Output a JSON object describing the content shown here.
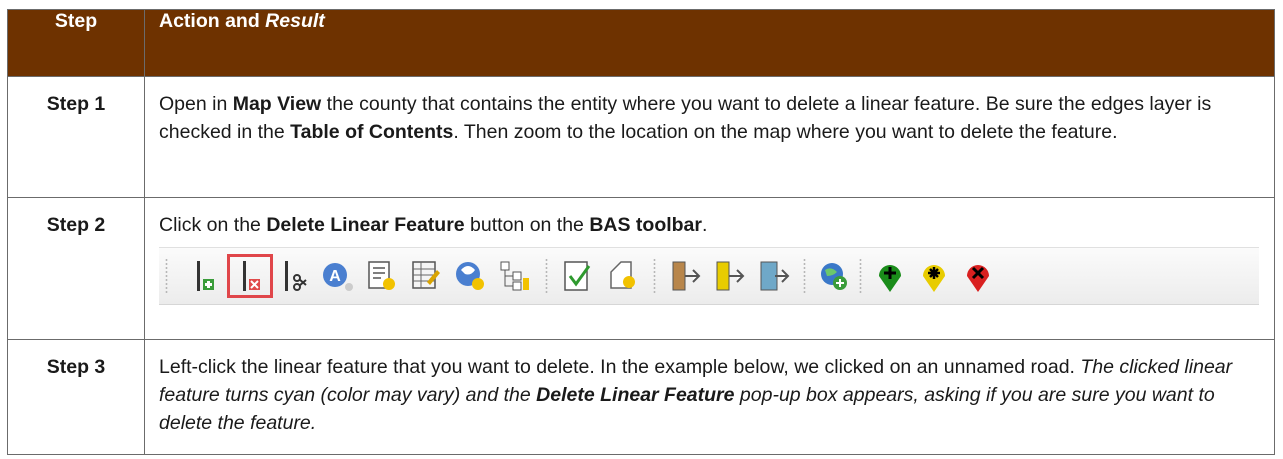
{
  "header": {
    "step": "Step",
    "action_prefix": "Action and ",
    "action_italic": "Result"
  },
  "rows": [
    {
      "step": "Step 1",
      "t1": "Open in ",
      "b1": "Map View",
      "t2": " the county that contains the entity where you want to delete a linear feature. Be sure the edges layer is checked in the ",
      "b2": "Table of Contents",
      "t3": ". Then zoom to the location on the map where you want to delete the feature."
    },
    {
      "step": "Step 2",
      "t1": "Click on the ",
      "b1": "Delete Linear Feature",
      "t2": " button on the ",
      "b2": "BAS toolbar",
      "t3": "."
    },
    {
      "step": "Step 3",
      "t1": "Left-click the linear feature that you want to delete. In the example below, we clicked on an unnamed road. ",
      "i1": "The clicked linear feature turns cyan (color may vary) and the ",
      "bi1": "Delete Linear Feature",
      "i2": " pop-up box appears, asking if you are sure you want to delete the feature."
    }
  ],
  "toolbar": {
    "icons": [
      "add-linear-feature-icon",
      "delete-linear-feature-icon",
      "split-linear-feature-icon",
      "add-area-landmark-icon",
      "add-note-icon",
      "attribute-table-icon",
      "identify-icon",
      "topology-icon",
      "validate-icon",
      "review-change-icon",
      "import-icon",
      "export-icon",
      "export-map-icon",
      "globe-add-icon",
      "add-point-icon",
      "modify-point-icon",
      "delete-point-icon"
    ],
    "selected": "delete-linear-feature-icon",
    "colors": {
      "green": "#1a8c1a",
      "red": "#d92020",
      "yellow": "#e8cc00"
    }
  },
  "colors": {
    "header_bg": "#6e3200",
    "border": "#6b6b6b"
  }
}
